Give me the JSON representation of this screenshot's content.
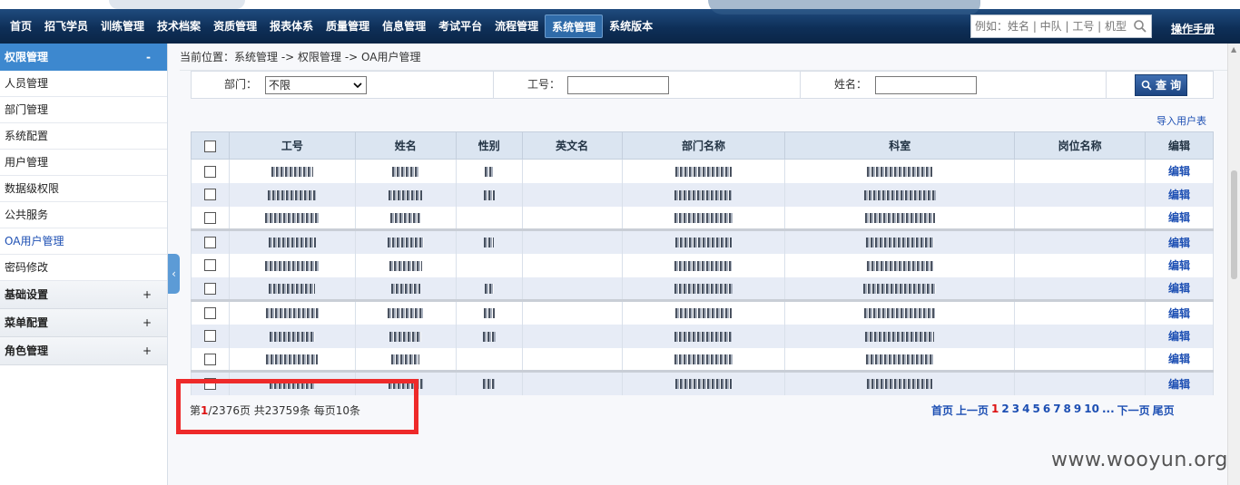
{
  "nav": {
    "items": [
      "首页",
      "招飞学员",
      "训练管理",
      "技术档案",
      "资质管理",
      "报表体系",
      "质量管理",
      "信息管理",
      "考试平台",
      "流程管理",
      "系统管理",
      "系统版本"
    ],
    "active_index": 10,
    "search_placeholder": "例如：姓名 | 中队 | 工号 | 机型",
    "manual_label": "操作手册"
  },
  "sidebar": {
    "section_title": "权限管理",
    "section_toggle": "-",
    "items": [
      "人员管理",
      "部门管理",
      "系统配置",
      "用户管理",
      "数据级权限",
      "公共服务",
      "OA用户管理",
      "密码修改"
    ],
    "active_item": "OA用户管理",
    "groups": [
      "基础设置",
      "菜单配置",
      "角色管理"
    ],
    "group_toggle": "+",
    "collapse_glyph": "‹"
  },
  "breadcrumb": "当前位置：系统管理 -> 权限管理 -> OA用户管理",
  "filter": {
    "dept_label": "部门：",
    "dept_value": "不限",
    "id_label": "工号：",
    "id_value": "",
    "name_label": "姓名：",
    "name_value": "",
    "query_label": "查 询"
  },
  "import_label": "导入用户表",
  "table": {
    "headers": [
      "工号",
      "姓名",
      "性别",
      "英文名",
      "部门名称",
      "科室",
      "岗位名称",
      "编辑"
    ],
    "edit_label": "编辑",
    "row_count": 10
  },
  "pagination": {
    "prefix": "第",
    "current": "1",
    "summary": "/2376页 共23759条 每页10条",
    "first": "首页",
    "prev": "上一页",
    "pages": [
      "1",
      "2",
      "3",
      "4",
      "5",
      "6",
      "7",
      "8",
      "9",
      "10"
    ],
    "ellipsis": "...",
    "next": "下一页",
    "last": "尾页"
  },
  "watermark": "www.wooyun.org",
  "colors": {
    "nav_bg": "#0e2f58",
    "sidebar_head": "#3d88cf",
    "link": "#1d4fb3",
    "highlight_box": "#ee2a2a"
  }
}
